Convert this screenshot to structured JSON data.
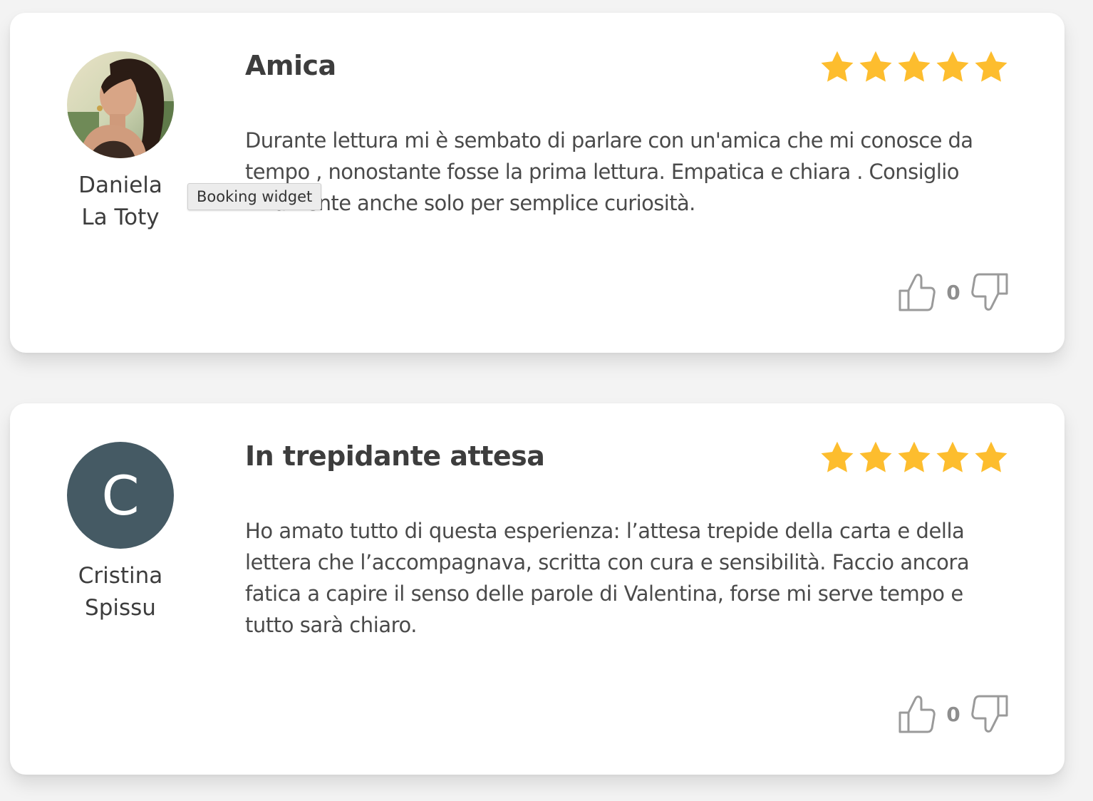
{
  "tooltip": {
    "text": "Booking widget"
  },
  "colors": {
    "star": "#fdbd2e",
    "avatar_initial_bg": "#455a64",
    "thumb_icon": "#9a9a9a"
  },
  "reviews": [
    {
      "author_first": "Daniela",
      "author_last": "La Toty",
      "avatar_type": "photo",
      "title": "Amica",
      "rating": 5,
      "text": "Durante lettura mi è sembato di parlare con un'amica che mi conosce da tempo , nonostante fosse la prima lettura. Empatica e chiara . Consiglio vivamente anche solo per semplice curiosità.",
      "votes": "0",
      "icons": {
        "like": "thumbs-up-icon",
        "dislike": "thumbs-down-icon",
        "star": "star-icon"
      }
    },
    {
      "author_first": "Cristina",
      "author_last": "Spissu",
      "avatar_type": "initial",
      "avatar_initial": "C",
      "title": "In trepidante attesa",
      "rating": 5,
      "text": "Ho amato tutto di questa esperienza: l’attesa trepide della carta e della lettera che l’accompagnava, scritta con cura e sensibilità. Faccio ancora fatica a capire il senso delle parole di Valentina, forse mi serve tempo e tutto sarà chiaro.",
      "votes": "0",
      "icons": {
        "like": "thumbs-up-icon",
        "dislike": "thumbs-down-icon",
        "star": "star-icon"
      }
    }
  ]
}
